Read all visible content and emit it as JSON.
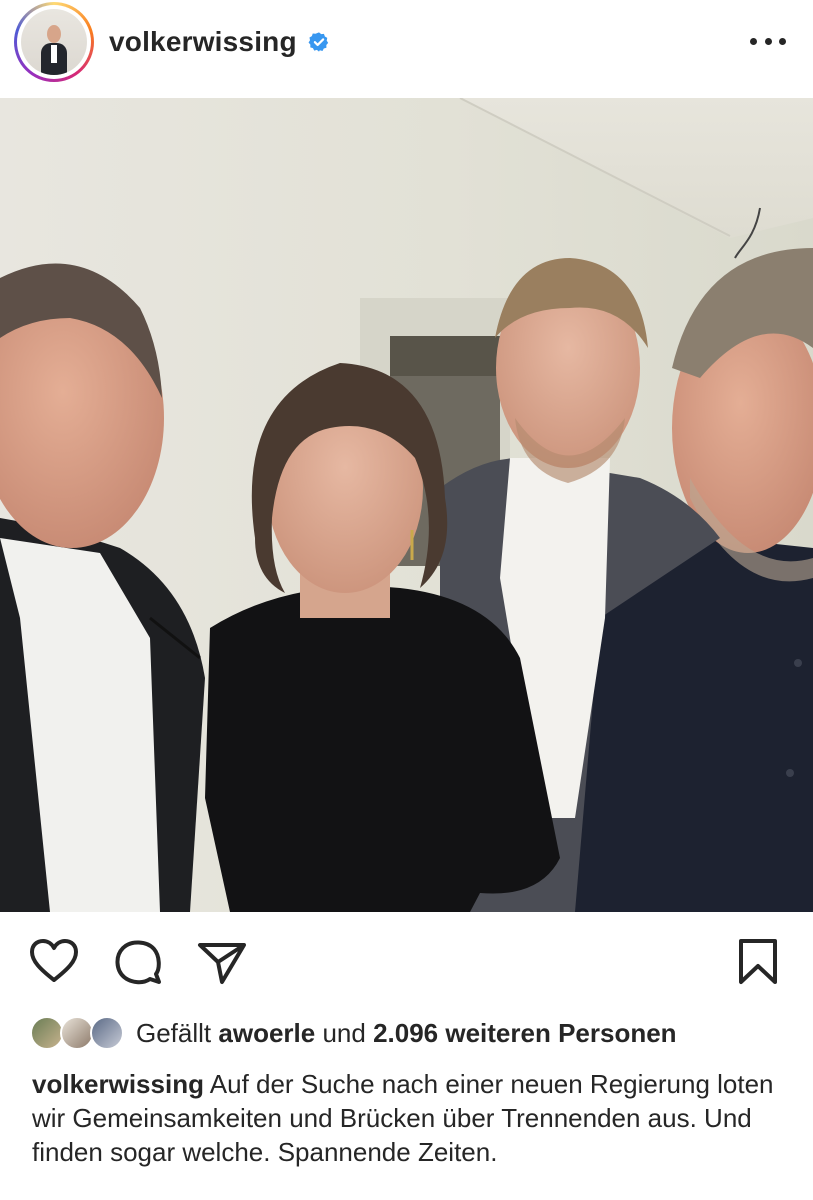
{
  "post": {
    "username": "volkerwissing",
    "more_icon": "more-horizontal-icon",
    "verified_icon": "verified-badge-icon",
    "accent_color": "#3897f0"
  },
  "actions": {
    "like_icon": "heart-icon",
    "comment_icon": "comment-icon",
    "share_icon": "send-icon",
    "save_icon": "bookmark-icon"
  },
  "likes": {
    "prefix": "Gefällt",
    "liker": "awoerle",
    "connector": "und",
    "count_text": "2.096 weiteren Personen"
  },
  "caption": {
    "username": "volkerwissing",
    "text": "Auf der Suche nach einer neuen Regierung loten wir Gemeinsamkeiten und Brücken über Trennenden aus. Und finden sogar welche. Spannende Zeiten."
  }
}
